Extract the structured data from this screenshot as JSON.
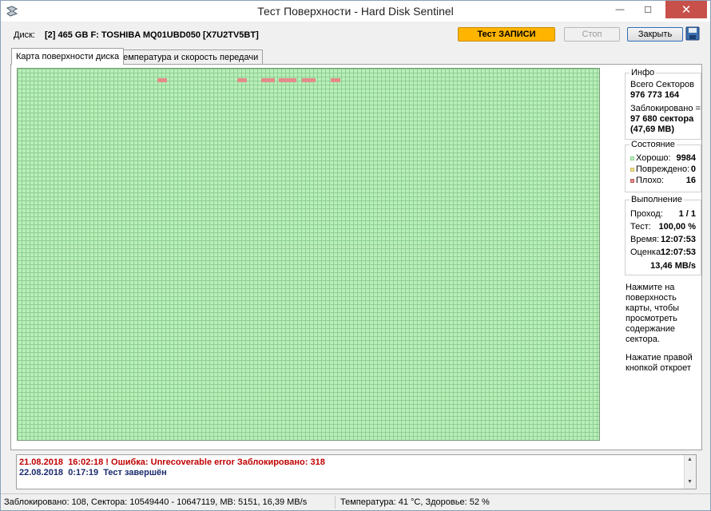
{
  "window": {
    "title": "Тест Поверхности - Hard Disk Sentinel",
    "minimize": "—",
    "maximize": "☐",
    "close": "✕"
  },
  "header": {
    "disk_label": "Диск:",
    "disk_value": "[2] 465 GB F: TOSHIBA MQ01UBD050 [X7U2TV5BT]",
    "write_test_button": "Тест ЗАПИСИ",
    "stop_button": "Стоп",
    "close_button": "Закрыть",
    "save_icon": "floppy-disk-icon"
  },
  "tabs": [
    {
      "label": "Карта поверхности диска",
      "active": true
    },
    {
      "label": "Температура и скорость передачи",
      "active": false
    }
  ],
  "info": {
    "title": "Инфо",
    "total_sectors_label": "Всего Секторов",
    "total_sectors_value": "976 773 164",
    "blocked_label": "Заблокировано =",
    "blocked_value": "97 680 сектора",
    "blocked_size": "(47,69 MB)"
  },
  "state": {
    "title": "Состояние",
    "good_label": "Хорошо:",
    "good_value": "9984",
    "damaged_label": "Повреждено:",
    "damaged_value": "0",
    "bad_label": "Плохо:",
    "bad_value": "16",
    "colors": {
      "good": "#b9efba",
      "damaged": "#f3e28a",
      "bad": "#e58a8a"
    }
  },
  "execution": {
    "title": "Выполнение",
    "pass_label": "Проход:",
    "pass_value": "1 / 1",
    "test_label": "Тест:",
    "test_value": "100,00 %",
    "time_label": "Время:",
    "time_value": "12:07:53",
    "estimate_label": "Оценка:",
    "estimate_value": "12:07:53",
    "speed": "13,46 MB/s"
  },
  "hints": {
    "click": "Нажмите на поверхность карты, чтобы просмотреть содержание сектора.",
    "right_click": "Нажатие правой кнопкой откроет"
  },
  "log": [
    {
      "date": "21.08.2018",
      "time": "16:02:18",
      "text": "! Ошибка: Unrecoverable error Заблокировано: 318",
      "color": "#c00000"
    },
    {
      "date": "22.08.2018",
      "time": "0:17:19",
      "text": "Тест завершён",
      "color": "#1a2a6c"
    }
  ],
  "status": {
    "left": "Заблокировано: 108, Сектора: 10549440 - 10647119, MB: 5151, 16,39 MB/s",
    "right": "Температура: 41  °C,  Здоровье: 52 %"
  }
}
